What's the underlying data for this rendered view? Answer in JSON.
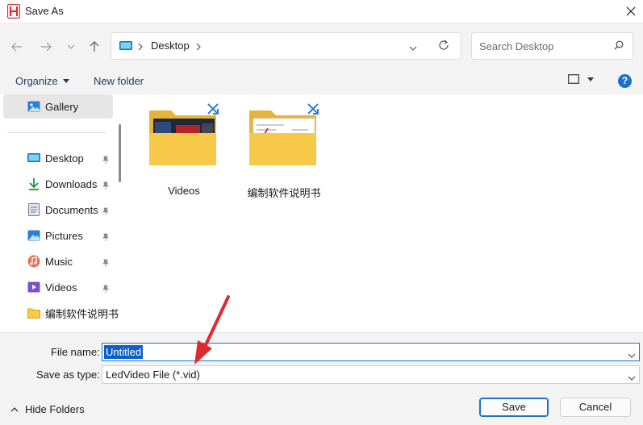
{
  "window": {
    "title": "Save As"
  },
  "nav": {
    "address_location": "Desktop",
    "search_placeholder": "Search Desktop"
  },
  "commandbar": {
    "organize_label": "Organize",
    "new_folder_label": "New folder"
  },
  "sidebar": {
    "gallery_label": "Gallery",
    "items": [
      {
        "label": "Desktop",
        "icon": "desktop-icon",
        "pinned": true
      },
      {
        "label": "Downloads",
        "icon": "download-icon",
        "pinned": true
      },
      {
        "label": "Documents",
        "icon": "document-icon",
        "pinned": true
      },
      {
        "label": "Pictures",
        "icon": "pictures-icon",
        "pinned": true
      },
      {
        "label": "Music",
        "icon": "music-icon",
        "pinned": true
      },
      {
        "label": "Videos",
        "icon": "videos-icon",
        "pinned": true
      },
      {
        "label": "编制软件说明书",
        "icon": "folder-icon",
        "pinned": false
      }
    ]
  },
  "main": {
    "folders": [
      {
        "label": "Videos",
        "icon": "folder-icon"
      },
      {
        "label": "编制软件说明书",
        "icon": "folder-icon"
      }
    ]
  },
  "bottom": {
    "file_name_label": "File name:",
    "file_name_value": "Untitled",
    "save_type_label": "Save as type:",
    "save_type_value": "LedVideo File (*.vid)",
    "hide_folders_label": "Hide Folders",
    "save_label": "Save",
    "cancel_label": "Cancel"
  },
  "colors": {
    "accent": "#1a73c9",
    "arrow": "#e0282d",
    "folder": "#f7c948"
  }
}
